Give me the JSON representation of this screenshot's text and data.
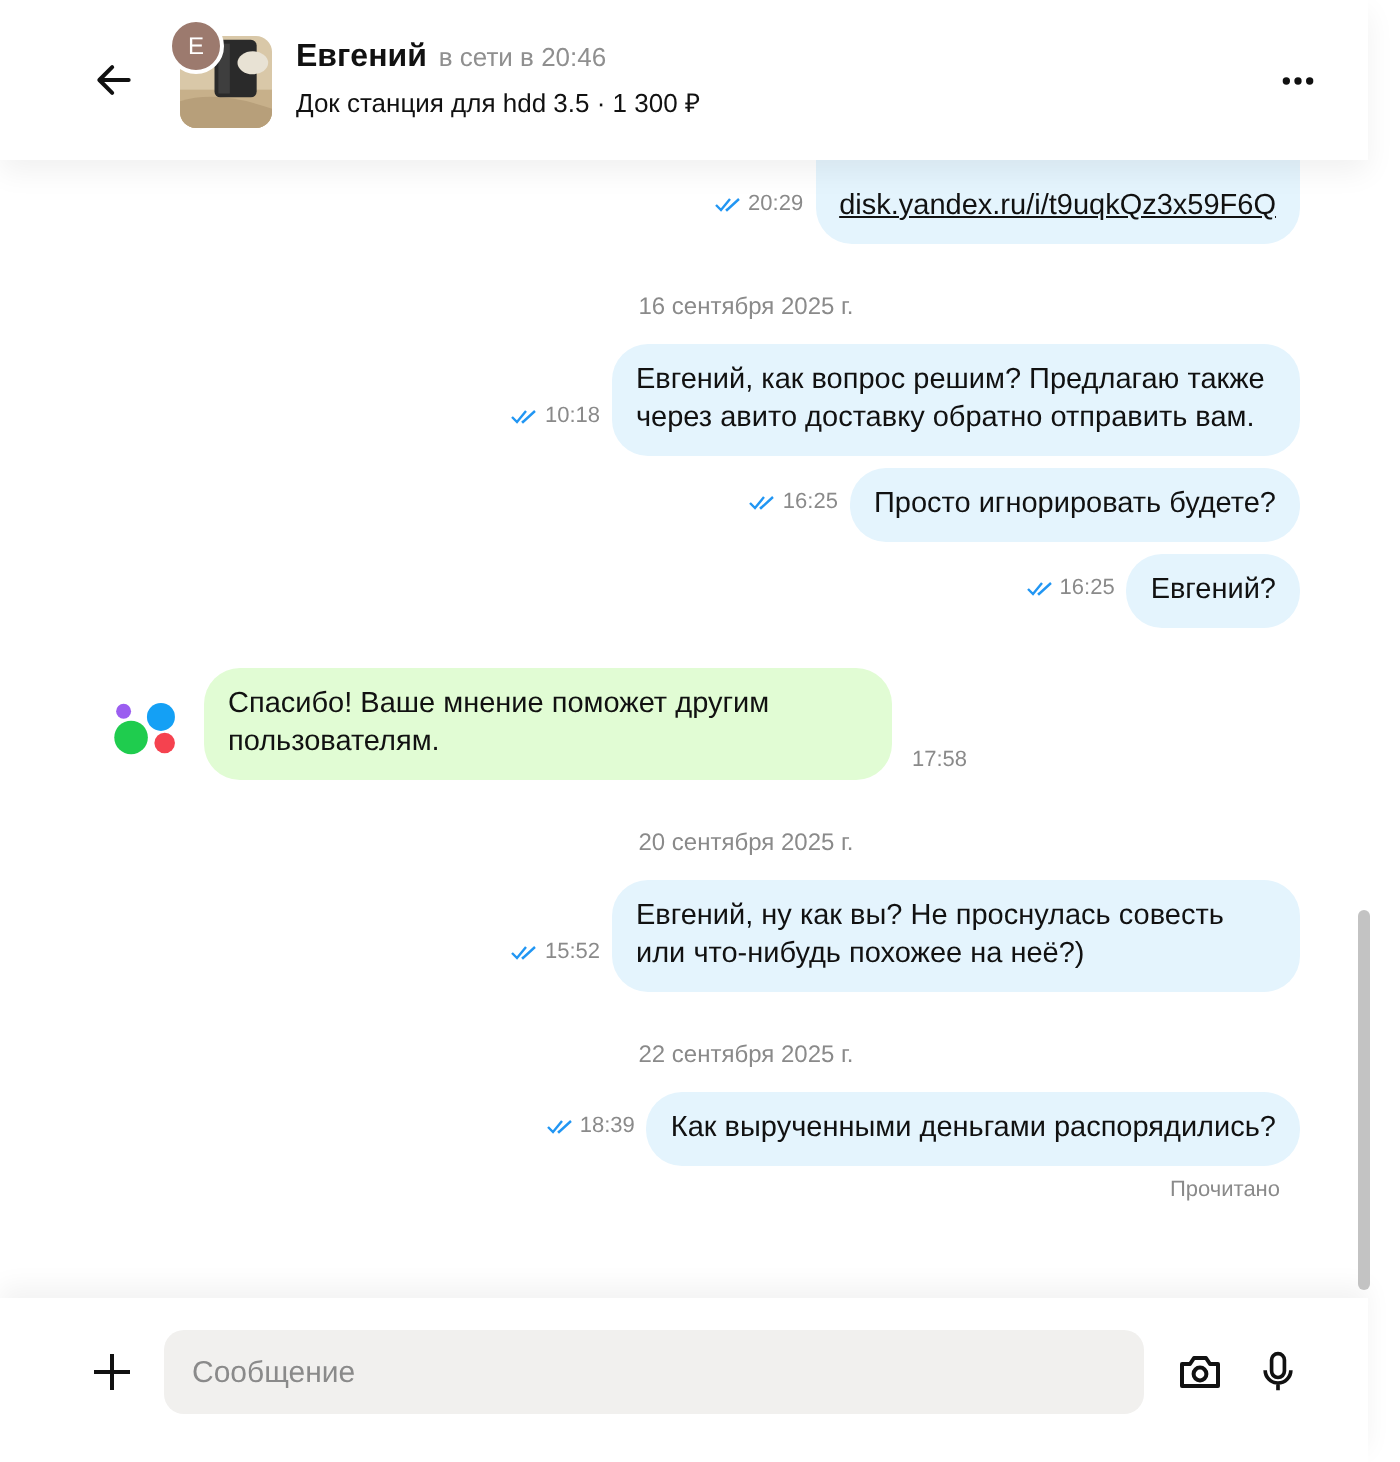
{
  "header": {
    "avatar_letter": "Е",
    "name": "Евгений",
    "status": "в сети в 20:46",
    "item": "Док станция для hdd 3.5 · 1 300 ₽"
  },
  "messages": [
    {
      "kind": "outgoing",
      "text": "disk.yandex.ru/i/t9uqkQz3x59F6Q",
      "link": true,
      "time": "20:29",
      "read": true
    },
    {
      "kind": "date",
      "text": "16 сентября 2025 г."
    },
    {
      "kind": "outgoing",
      "text": "Евгений, как вопрос решим? Предлагаю также через авито доставку обратно отправить вам.",
      "time": "10:18",
      "read": true
    },
    {
      "kind": "outgoing",
      "text": "Просто игнорировать будете?",
      "time": "16:25",
      "read": true
    },
    {
      "kind": "outgoing",
      "text": "Евгений?",
      "time": "16:25",
      "read": true
    },
    {
      "kind": "system",
      "text": "Спасибо! Ваше мнение поможет другим пользователям.",
      "time": "17:58"
    },
    {
      "kind": "date",
      "text": "20 сентября 2025 г."
    },
    {
      "kind": "outgoing",
      "text": "Евгений, ну как вы? Не проснулась совесть или что-нибудь похожее на неё?)",
      "time": "15:52",
      "read": true
    },
    {
      "kind": "date",
      "text": "22 сентября 2025 г."
    },
    {
      "kind": "outgoing",
      "text": "Как вырученными деньгами распорядились?",
      "time": "18:39",
      "read": true
    }
  ],
  "read_receipt": "Прочитано",
  "composer": {
    "placeholder": "Сообщение"
  }
}
